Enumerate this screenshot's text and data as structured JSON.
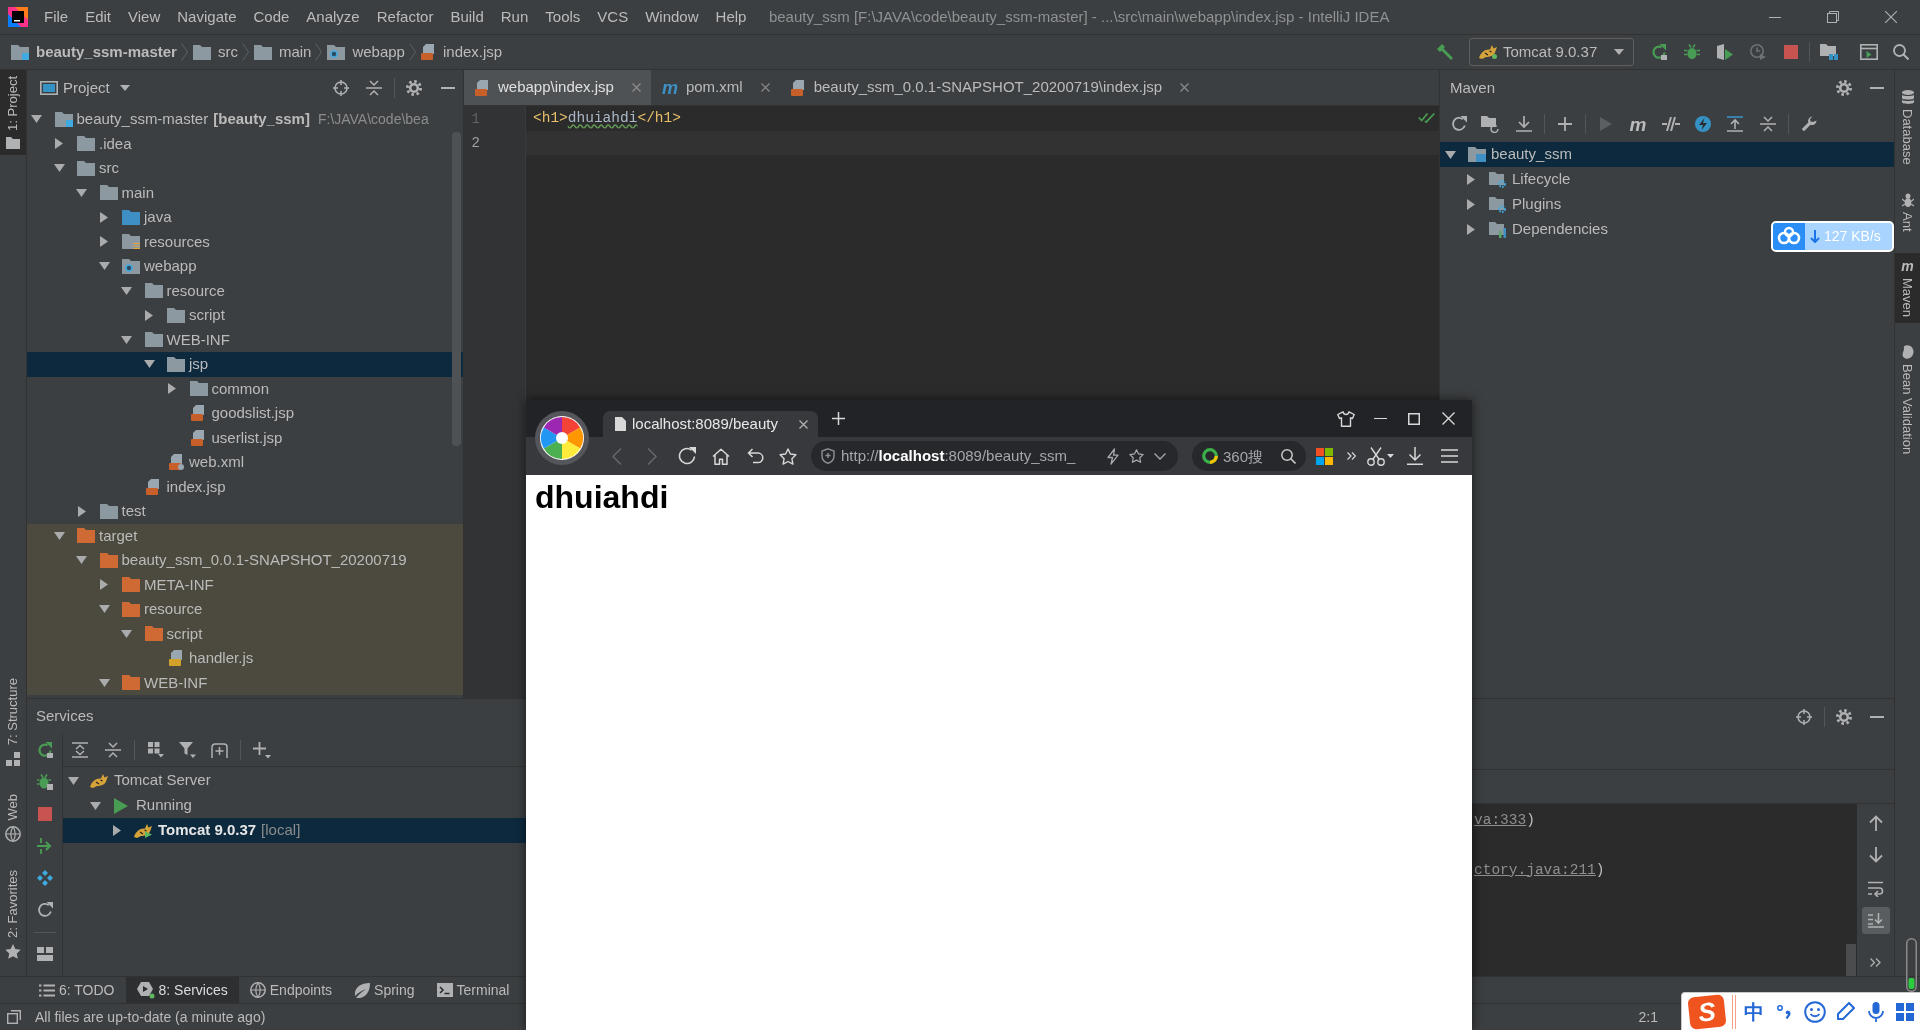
{
  "window": {
    "title": "beauty_ssm [F:\\JAVA\\code\\beauty_ssm-master] - ...\\src\\main\\webapp\\index.jsp - IntelliJ IDEA"
  },
  "menu": [
    "File",
    "Edit",
    "View",
    "Navigate",
    "Code",
    "Analyze",
    "Refactor",
    "Build",
    "Run",
    "Tools",
    "VCS",
    "Window",
    "Help"
  ],
  "breadcrumb": [
    {
      "label": "beauty_ssm-master",
      "kind": "module"
    },
    {
      "label": "src",
      "kind": "folder"
    },
    {
      "label": "main",
      "kind": "folder"
    },
    {
      "label": "webapp",
      "kind": "web-folder"
    },
    {
      "label": "index.jsp",
      "kind": "jsp-file"
    }
  ],
  "run_configuration": {
    "label": "Tomcat 9.0.37"
  },
  "left_strip": {
    "top": [
      {
        "label": "1: Project",
        "kind": "project",
        "selected": true
      }
    ],
    "bottom": [
      {
        "label": "7: Structure",
        "kind": "structure",
        "selected": false
      },
      {
        "label": "Web",
        "kind": "web",
        "selected": false
      },
      {
        "label": "2: Favorites",
        "kind": "favorites",
        "selected": false
      }
    ]
  },
  "project_panel": {
    "title": "Project",
    "tree": [
      {
        "label": "beauty_ssm-master",
        "module": "[beauty_ssm]",
        "path": "F:\\JAVA\\code\\bea",
        "kind": "module",
        "expanded": true,
        "selected": false,
        "excluded": false,
        "children": [
          {
            "label": ".idea",
            "kind": "folder",
            "expanded": false,
            "selected": false,
            "excluded": false
          },
          {
            "label": "src",
            "kind": "folder",
            "expanded": true,
            "selected": false,
            "excluded": false,
            "children": [
              {
                "label": "main",
                "kind": "folder",
                "expanded": true,
                "selected": false,
                "excluded": false,
                "children": [
                  {
                    "label": "java",
                    "kind": "source-folder",
                    "expanded": false,
                    "selected": false,
                    "excluded": false
                  },
                  {
                    "label": "resources",
                    "kind": "resources-folder",
                    "expanded": false,
                    "selected": false,
                    "excluded": false
                  },
                  {
                    "label": "webapp",
                    "kind": "web-folder",
                    "expanded": true,
                    "selected": false,
                    "excluded": false,
                    "children": [
                      {
                        "label": "resource",
                        "kind": "folder",
                        "expanded": true,
                        "selected": false,
                        "excluded": false,
                        "children": [
                          {
                            "label": "script",
                            "kind": "folder",
                            "expanded": false,
                            "selected": false,
                            "excluded": false
                          }
                        ]
                      },
                      {
                        "label": "WEB-INF",
                        "kind": "folder",
                        "expanded": true,
                        "selected": false,
                        "excluded": false,
                        "children": [
                          {
                            "label": "jsp",
                            "kind": "folder",
                            "expanded": true,
                            "selected": true,
                            "excluded": false,
                            "children": [
                              {
                                "label": "common",
                                "kind": "folder",
                                "expanded": false,
                                "selected": false,
                                "excluded": false
                              },
                              {
                                "label": "goodslist.jsp",
                                "kind": "jsp-file",
                                "selected": false,
                                "excluded": false
                              },
                              {
                                "label": "userlist.jsp",
                                "kind": "jsp-file",
                                "selected": false,
                                "excluded": false
                              }
                            ]
                          },
                          {
                            "label": "web.xml",
                            "kind": "xml-file",
                            "selected": false,
                            "excluded": false
                          }
                        ]
                      },
                      {
                        "label": "index.jsp",
                        "kind": "jsp-file",
                        "selected": false,
                        "excluded": false
                      }
                    ]
                  }
                ]
              },
              {
                "label": "test",
                "kind": "folder",
                "expanded": false,
                "selected": false,
                "excluded": false
              }
            ]
          },
          {
            "label": "target",
            "kind": "excluded-folder",
            "expanded": true,
            "selected": false,
            "excluded": true,
            "children": [
              {
                "label": "beauty_ssm_0.0.1-SNAPSHOT_20200719",
                "kind": "excluded-folder",
                "expanded": true,
                "selected": false,
                "excluded": true,
                "children": [
                  {
                    "label": "META-INF",
                    "kind": "excluded-folder",
                    "expanded": false,
                    "selected": false,
                    "excluded": true
                  },
                  {
                    "label": "resource",
                    "kind": "excluded-folder",
                    "expanded": true,
                    "selected": false,
                    "excluded": true,
                    "children": [
                      {
                        "label": "script",
                        "kind": "excluded-folder",
                        "expanded": true,
                        "selected": false,
                        "excluded": true,
                        "children": [
                          {
                            "label": "handler.js",
                            "kind": "js-file",
                            "selected": false,
                            "excluded": true
                          }
                        ]
                      }
                    ]
                  },
                  {
                    "label": "WEB-INF",
                    "kind": "excluded-folder",
                    "expanded": true,
                    "selected": false,
                    "excluded": true
                  }
                ]
              }
            ]
          }
        ]
      }
    ]
  },
  "editor": {
    "tabs": [
      {
        "label": "webapp\\index.jsp",
        "kind": "jsp-file",
        "selected": true
      },
      {
        "label": "pom.xml",
        "kind": "maven",
        "glyph": "m",
        "selected": false
      },
      {
        "label": "beauty_ssm_0.0.1-SNAPSHOT_20200719\\index.jsp",
        "kind": "jsp-file",
        "selected": false
      }
    ],
    "lines": [
      {
        "number": "1",
        "current": false,
        "tokens": [
          {
            "text": "<h1>",
            "kind": "tag",
            "misspelled": false
          },
          {
            "text": "dhuiahdi",
            "kind": "text",
            "misspelled": true
          },
          {
            "text": "</h1>",
            "kind": "tag",
            "misspelled": false
          }
        ]
      },
      {
        "number": "2",
        "current": true
      }
    ]
  },
  "maven": {
    "title": "Maven",
    "goal_glyph": "m",
    "tree": [
      {
        "label": "beauty_ssm",
        "kind": "maven-project",
        "expanded": true,
        "selected": true,
        "children": [
          {
            "label": "Lifecycle",
            "kind": "config-folder",
            "expanded": false,
            "selected": false
          },
          {
            "label": "Plugins",
            "kind": "config-folder",
            "expanded": false,
            "selected": false
          },
          {
            "label": "Dependencies",
            "kind": "dependencies",
            "expanded": false,
            "selected": false
          }
        ]
      }
    ]
  },
  "right_strip": [
    {
      "label": "Database",
      "kind": "database",
      "selected": false
    },
    {
      "label": "Ant",
      "kind": "ant",
      "selected": false
    },
    {
      "label": "Maven",
      "kind": "maven",
      "glyph": "m",
      "selected": true
    },
    {
      "label": "Bean Validation",
      "kind": "bean",
      "selected": false
    }
  ],
  "download_widget": {
    "speed": "127 KB/s"
  },
  "services": {
    "title": "Services",
    "tree": [
      {
        "label": "Tomcat Server",
        "kind": "server",
        "expanded": true,
        "selected": false,
        "children": [
          {
            "label": "Running",
            "kind": "running",
            "expanded": true,
            "selected": false,
            "children": [
              {
                "label": "Tomcat 9.0.37",
                "detail": "[local]",
                "kind": "tomcat",
                "expanded": false,
                "selected": true
              }
            ]
          }
        ]
      }
    ],
    "console": [
      {
        "link": "va:333",
        "rest": ")"
      },
      {
        "link": "ctory.java:211",
        "rest": ")"
      }
    ],
    "scroll_to_end_on": true
  },
  "tool_tabs": [
    {
      "label": "6: TODO",
      "kind": "todo",
      "selected": false
    },
    {
      "label": "8: Services",
      "kind": "services",
      "selected": true
    },
    {
      "label": "Endpoints",
      "kind": "endpoints",
      "selected": false
    },
    {
      "label": "Spring",
      "kind": "spring",
      "selected": false
    },
    {
      "label": "Terminal",
      "kind": "terminal",
      "selected": false
    }
  ],
  "status_bar": {
    "message": "All files are up-to-date (a minute ago)",
    "caret": "2:1"
  },
  "browser": {
    "tab": {
      "title": "localhost:8089/beauty"
    },
    "back": {
      "disabled": true
    },
    "forward": {
      "disabled": true
    },
    "address": "http://**localhost**:8089/beauty_ssm_",
    "search": {
      "placeholder": "360搜"
    },
    "page": {
      "heading": "dhuiahdi"
    }
  },
  "ime": {
    "logo": "S",
    "mode": "中"
  }
}
